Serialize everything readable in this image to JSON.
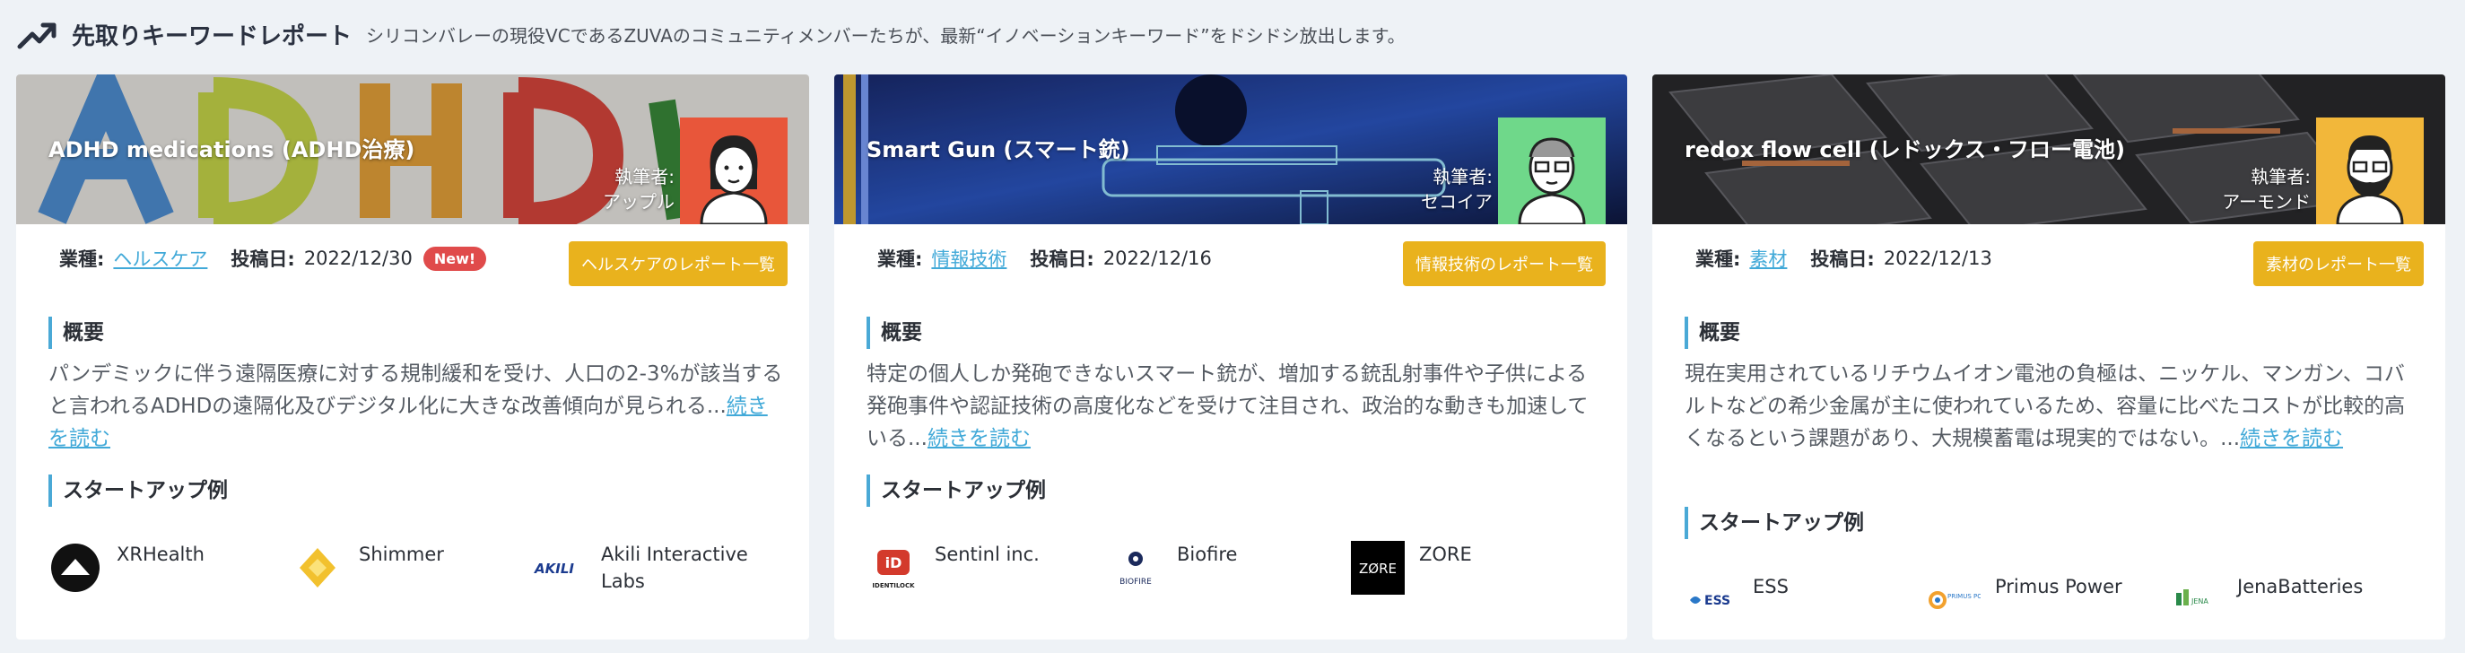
{
  "header": {
    "title": "先取りキーワードレポート",
    "subtitle": "シリコンバレーの現役VCであるZUVAのコミュニティメンバーたちが、最新“イノベーションキーワード”をドシドシ放出します。"
  },
  "labels": {
    "industry": "業種:",
    "posted": "投稿日:",
    "overview": "概要",
    "startups": "スタートアップ例",
    "read_more": "続きを読む"
  },
  "cards": [
    {
      "title": "ADHD medications (ADHD治療)",
      "author_label": "執筆者:",
      "author": "アップル",
      "industry": "ヘルスケア",
      "date": "2022/12/30",
      "badge": "New!",
      "report_button": "ヘルスケアのレポート一覧",
      "summary": "パンデミックに伴う遠隔医療に対する規制緩和を受け、人口の2-3%が該当すると言われるADHDの遠隔化及びデジタル化に大きな改善傾向が見られる...",
      "startups": [
        "XRHealth",
        "Shimmer",
        "Akili Interactive Labs"
      ]
    },
    {
      "title": "Smart Gun (スマート銃)",
      "author_label": "執筆者:",
      "author": "セコイア",
      "industry": "情報技術",
      "date": "2022/12/16",
      "report_button": "情報技術のレポート一覧",
      "summary": "特定の個人しか発砲できないスマート銃が、増加する銃乱射事件や子供による発砲事件や認証技術の高度化などを受けて注目され、政治的な動きも加速している...",
      "startups": [
        "Sentinl inc.",
        "Biofire",
        "ZORE"
      ]
    },
    {
      "title": "redox flow cell (レドックス・フロー電池)",
      "author_label": "執筆者:",
      "author": "アーモンド",
      "industry": "素材",
      "date": "2022/12/13",
      "report_button": "素材のレポート一覧",
      "summary": "現在実用されているリチウムイオン電池の負極は、ニッケル、マンガン、コバルトなどの希少金属が主に使われているため、容量に比べたコストが比較的高くなるという課題があり、大規模蓄電は現実的ではない。...",
      "startups": [
        "ESS",
        "Primus Power",
        "JenaBatteries"
      ]
    }
  ],
  "logo_text": {
    "zore": "ZØRE",
    "akili": "AKILI",
    "identilock": "IDENTILOCK",
    "biofire": "BIOFIRE",
    "ess": "ESS",
    "primus": "PRIMUS POWER",
    "jena": "JENA"
  },
  "colors": {
    "accent_yellow": "#e9b21d",
    "link_blue": "#41a9d8",
    "new_badge": "#e04b4b",
    "avatar_bg_1": "#e8563a",
    "avatar_bg_2": "#6fd88a",
    "avatar_bg_3": "#f2b73a"
  }
}
